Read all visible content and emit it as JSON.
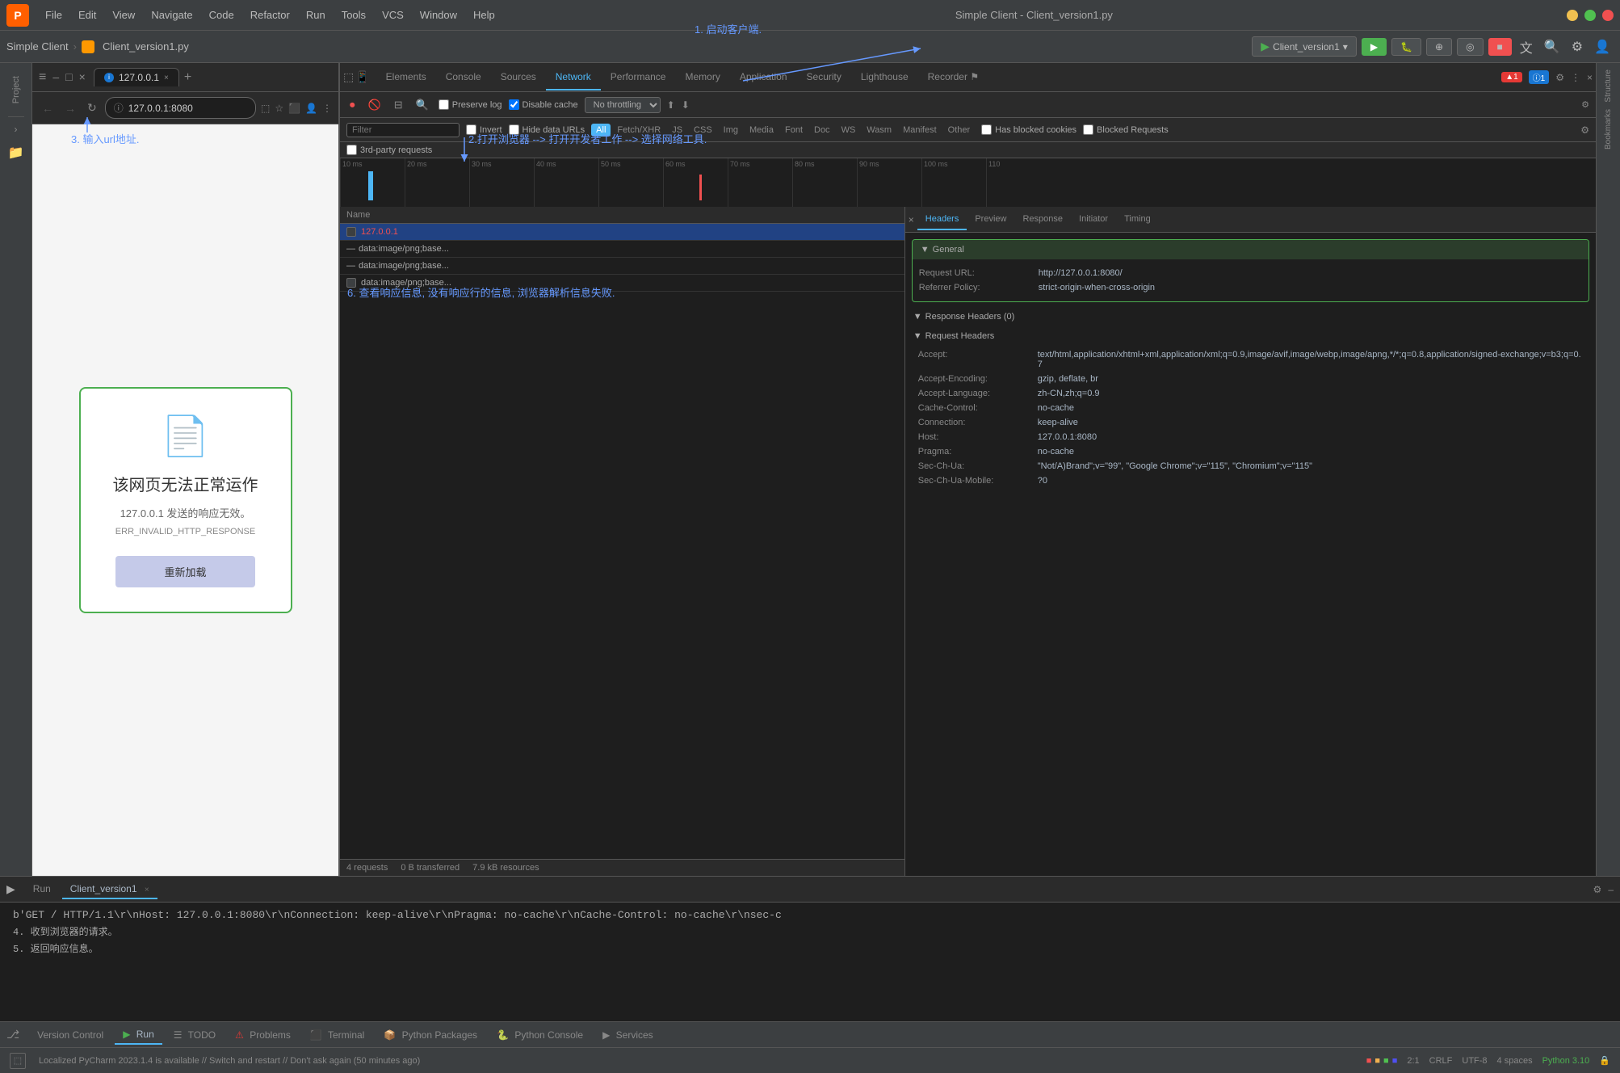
{
  "ide": {
    "logo": "P",
    "title": "Simple  Client - Client_version1.py",
    "menu": [
      "File",
      "Edit",
      "View",
      "Navigate",
      "Code",
      "Refactor",
      "Run",
      "Tools",
      "VCS",
      "Window",
      "Help"
    ],
    "breadcrumb": [
      "Simple Client",
      "Client_version1.py"
    ],
    "run_config": "Client_version1",
    "win_controls": [
      "–",
      "□",
      "×"
    ]
  },
  "browser": {
    "tab_title": "127.0.0.1",
    "tab_close": "×",
    "new_tab": "+",
    "address": "127.0.0.1:8080",
    "error_title": "该网页无法正常运作",
    "error_subtitle": "127.0.0.1 发送的响应无效。",
    "error_code": "ERR_INVALID_HTTP_RESPONSE",
    "reload_btn": "重新加载"
  },
  "devtools": {
    "tabs": [
      "Elements",
      "Console",
      "Sources",
      "Network",
      "Performance",
      "Memory",
      "Application",
      "Security",
      "Lighthouse",
      "Recorder ⚑"
    ],
    "active_tab": "Network",
    "toolbar": {
      "preserve_log": "Preserve log",
      "disable_cache": "Disable cache",
      "no_throttling": "No throttling"
    },
    "filter": {
      "placeholder": "Filter",
      "invert": "Invert",
      "hide_data_urls": "Hide data URLs",
      "types": [
        "All",
        "Fetch/XHR",
        "JS",
        "CSS",
        "Img",
        "Media",
        "Font",
        "Doc",
        "WS",
        "Wasm",
        "Manifest",
        "Other"
      ],
      "active_type": "All",
      "has_blocked": "Has blocked cookies",
      "blocked_requests": "Blocked Requests"
    },
    "timeline": {
      "marks": [
        "10 ms",
        "20 ms",
        "30 ms",
        "40 ms",
        "50 ms",
        "60 ms",
        "70 ms",
        "80 ms",
        "90 ms",
        "100 ms",
        "110"
      ]
    },
    "network_list": {
      "header": "Name",
      "rows": [
        {
          "name": "127.0.0.1",
          "type": "url",
          "color": "red"
        },
        {
          "name": "data:image/png;base...",
          "type": "data"
        },
        {
          "name": "data:image/png;base...",
          "type": "data"
        },
        {
          "name": "data:image/png;base...",
          "type": "data"
        }
      ]
    },
    "headers": {
      "tabs": [
        "Headers",
        "Preview",
        "Response",
        "Initiator",
        "Timing"
      ],
      "active_tab": "Headers",
      "general_section": {
        "title": "General",
        "rows": [
          {
            "key": "Request URL:",
            "value": "http://127.0.0.1:8080/"
          },
          {
            "key": "Referrer Policy:",
            "value": "strict-origin-when-cross-origin"
          }
        ]
      },
      "response_section": {
        "title": "Response Headers (0)"
      },
      "request_section": {
        "title": "Request Headers",
        "rows": [
          {
            "key": "Accept:",
            "value": "text/html,application/xhtml+xml,application/xml;q=0.9,image/avif,image/webp,image/apng,*/*;q=0.8,application/signed-exchange;v=b3;q=0.7"
          },
          {
            "key": "Accept-Encoding:",
            "value": "gzip, deflate, br"
          },
          {
            "key": "Accept-Language:",
            "value": "zh-CN,zh;q=0.9"
          },
          {
            "key": "Cache-Control:",
            "value": "no-cache"
          },
          {
            "key": "Connection:",
            "value": "keep-alive"
          },
          {
            "key": "Host:",
            "value": "127.0.0.1:8080"
          },
          {
            "key": "Pragma:",
            "value": "no-cache"
          },
          {
            "key": "Sec-Ch-Ua:",
            "value": "\"Not/A)Brand\";v=\"99\", \"Google Chrome\";v=\"115\", \"Chromium\";v=\"115\""
          },
          {
            "key": "Sec-Ch-Ua-Mobile:",
            "value": "?0"
          }
        ]
      }
    },
    "footer": {
      "requests": "4 requests",
      "transferred": "0 B transferred",
      "resources": "7.9 kB resources"
    }
  },
  "run_panel": {
    "tab_label": "Run",
    "tab2_label": "Client_version1",
    "content": "b'GET / HTTP/1.1\\r\\nHost: 127.0.0.1:8080\\r\\nConnection: keep-alive\\r\\nPragma: no-cache\\r\\nCache-Control: no-cache\\r\\nsec-c",
    "annotation4": "4. 收到浏览器的请求。",
    "annotation5": "5. 返回响应信息。"
  },
  "annotations": {
    "ann1": "1. 启动客户端.",
    "ann2": "2.打开浏览器 --> 打开开发者工作 --> 选择网络工具.",
    "ann3": "3. 输入url地址.",
    "ann6": "6. 查看响应信息, 没有响应行的信息, 浏览器解析信息失败."
  },
  "status_bar": {
    "version_control": "Version Control",
    "run": "Run",
    "todo": "TODO",
    "problems": "Problems",
    "terminal": "Terminal",
    "python_packages": "Python Packages",
    "python_console": "Python Console",
    "services": "Services",
    "notification": "Localized PyCharm 2023.1.4 is available // Switch and restart // Don't ask again (50 minutes ago)",
    "cursor": "2:1",
    "encoding": "CRLF",
    "charset": "UTF-8",
    "indent": "4 spaces",
    "python_version": "Python 3.10"
  }
}
